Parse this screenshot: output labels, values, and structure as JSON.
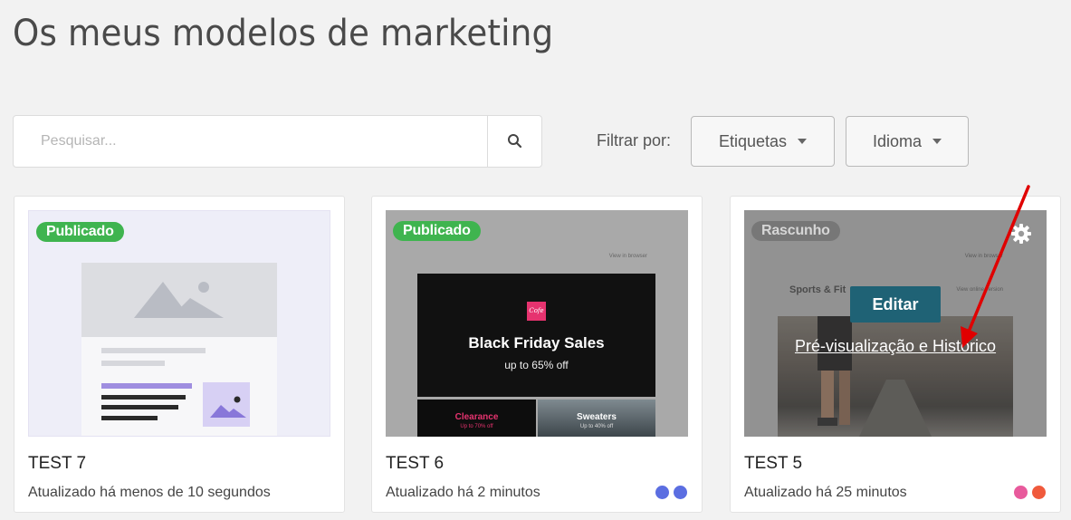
{
  "page": {
    "title": "Os meus modelos de marketing"
  },
  "search": {
    "placeholder": "Pesquisar...",
    "value": ""
  },
  "filters": {
    "label": "Filtrar por:",
    "tags_label": "Etiquetas",
    "language_label": "Idioma"
  },
  "cards": [
    {
      "status": "Publicado",
      "name": "TEST 7",
      "updated": "Atualizado há menos de 10 segundos",
      "dots": []
    },
    {
      "status": "Publicado",
      "name": "TEST 6",
      "updated": "Atualizado há 2 minutos",
      "dots": [
        "#5b6ee1",
        "#5b6ee1"
      ],
      "preview": {
        "view_online": "View in browser",
        "logo": "Cofe",
        "headline": "Black Friday Sales",
        "subline": "up to 65% off",
        "left_title": "Clearance",
        "left_sub": "Up to 70% off",
        "right_title": "Sweaters",
        "right_sub": "Up to 40% off"
      }
    },
    {
      "status": "Rascunho",
      "name": "TEST 5",
      "updated": "Atualizado há 25 minutos",
      "dots": [
        "#e85a9c",
        "#f05a3c"
      ],
      "preview": {
        "view_online": "View in browser",
        "brand": "Sports & Fit",
        "view_link": "View online version"
      },
      "overlay": {
        "edit_label": "Editar",
        "preview_link": "Pré-visualização e Histórico"
      }
    }
  ],
  "colors": {
    "published": "#3fb44f",
    "draft": "#777777",
    "edit_button": "#1f6275",
    "annotation_arrow": "#e00000"
  }
}
